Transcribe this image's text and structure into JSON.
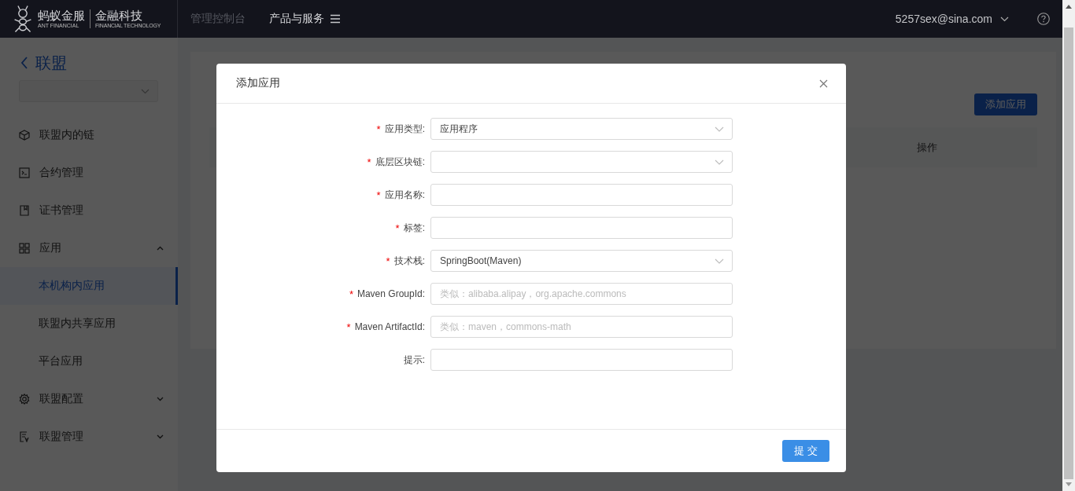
{
  "header": {
    "logo": {
      "name": "蚂蚁金服",
      "name_en": "ANT FINANCIAL",
      "sub": "金融科技",
      "sub_en": "FINANCIAL TECHNOLOGY"
    },
    "nav": [
      {
        "label": "管理控制台",
        "selected": false
      },
      {
        "label": "产品与服务",
        "selected": true
      }
    ],
    "user": "5257sex@sina.com"
  },
  "sidebar": {
    "back": "联盟",
    "items": [
      {
        "label": "联盟内的链",
        "kind": "item"
      },
      {
        "label": "合约管理",
        "kind": "item"
      },
      {
        "label": "证书管理",
        "kind": "item"
      },
      {
        "label": "应用",
        "kind": "group",
        "expanded": true,
        "children": [
          {
            "label": "本机构内应用",
            "selected": true
          },
          {
            "label": "联盟内共享应用",
            "selected": false
          },
          {
            "label": "平台应用",
            "selected": false
          }
        ]
      },
      {
        "label": "联盟配置",
        "kind": "group",
        "expanded": false
      },
      {
        "label": "联盟管理",
        "kind": "group",
        "expanded": false
      }
    ]
  },
  "page": {
    "add_button": "添加应用",
    "table": {
      "columns": [
        "操作"
      ]
    }
  },
  "dialog": {
    "title": "添加应用",
    "fields": [
      {
        "label": "应用类型:",
        "required": true,
        "kind": "select",
        "value": "应用程序"
      },
      {
        "label": "底层区块链:",
        "required": true,
        "kind": "select"
      },
      {
        "label": "应用名称:",
        "required": true,
        "kind": "input"
      },
      {
        "label": "标签:",
        "required": true,
        "kind": "input"
      },
      {
        "label": "技术栈:",
        "required": true,
        "kind": "select",
        "value": "SpringBoot(Maven)"
      },
      {
        "label": "Maven GroupId:",
        "required": true,
        "kind": "input",
        "placeholder": "类似：alibaba.alipay，org.apache.commons"
      },
      {
        "label": "Maven ArtifactId:",
        "required": true,
        "kind": "input",
        "placeholder": "类似：maven，commons-math"
      },
      {
        "label": "提示:",
        "required": false,
        "kind": "input"
      }
    ],
    "required_mark": "*",
    "submit": "提 交"
  }
}
